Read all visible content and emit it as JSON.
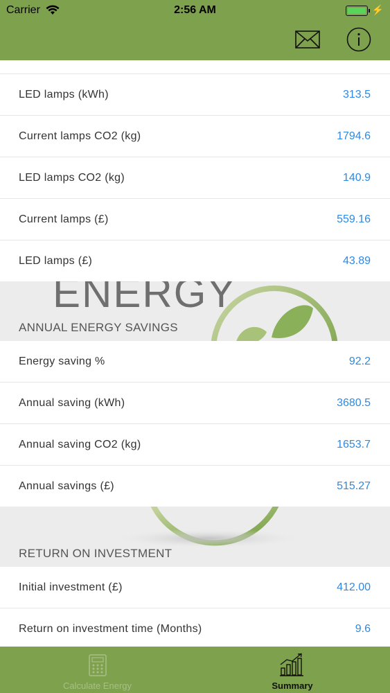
{
  "status_bar": {
    "carrier": "Carrier",
    "time": "2:56 AM",
    "bolt": "⚡"
  },
  "nav_bar": {
    "mail_icon": "mail-icon",
    "info_icon": "info-icon"
  },
  "background": {
    "watermark_text": "ENERGY"
  },
  "comparison": {
    "rows": [
      {
        "label": "LED lamps (kWh)",
        "value": "313.5"
      },
      {
        "label": "Current lamps CO2 (kg)",
        "value": "1794.6"
      },
      {
        "label": "LED lamps CO2 (kg)",
        "value": "140.9"
      },
      {
        "label": "Current lamps (£)",
        "value": "559.16"
      },
      {
        "label": "LED lamps (£)",
        "value": "43.89"
      }
    ]
  },
  "annual_savings": {
    "header": "ANNUAL ENERGY SAVINGS",
    "rows": [
      {
        "label": "Energy saving %",
        "value": "92.2"
      },
      {
        "label": "Annual saving (kWh)",
        "value": "3680.5"
      },
      {
        "label": "Annual saving CO2 (kg)",
        "value": "1653.7"
      },
      {
        "label": "Annual savings (£)",
        "value": "515.27"
      }
    ]
  },
  "roi": {
    "header": "RETURN ON INVESTMENT",
    "rows": [
      {
        "label": "Initial investment (£)",
        "value": "412.00"
      },
      {
        "label": "Return on investment time (Months)",
        "value": "9.6"
      }
    ]
  },
  "tab_bar": {
    "tabs": [
      {
        "label": "Calculate Energy",
        "icon": "calculator-icon",
        "selected": false
      },
      {
        "label": "Summary",
        "icon": "bar-chart-icon",
        "selected": true
      }
    ]
  },
  "colors": {
    "bar_green": "#7ea14d",
    "value_blue": "#2c8ae4",
    "battery_green": "#58d35c"
  }
}
